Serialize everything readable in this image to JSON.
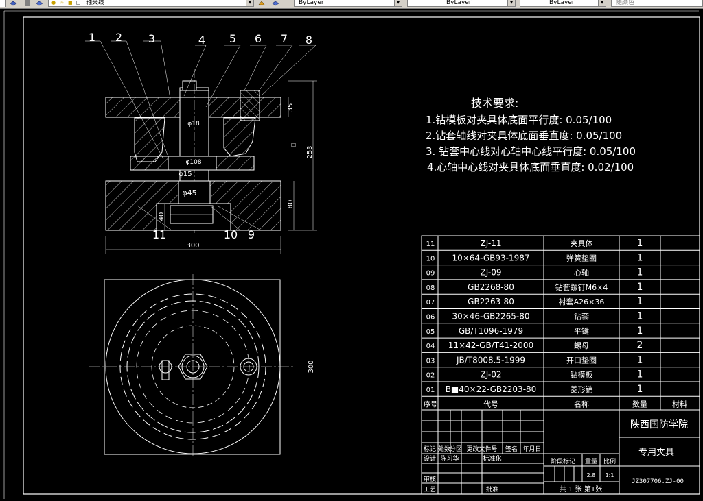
{
  "toolbar": {
    "layer_name": "轴夹线",
    "color_value": "ByLayer",
    "linetype_value": "ByLayer",
    "lineweight_value": "ByLayer",
    "plotstyle_value": "随颜色"
  },
  "drawing": {
    "balloons": [
      "1",
      "2",
      "3",
      "4",
      "5",
      "6",
      "7",
      "8",
      "9",
      "10",
      "11"
    ],
    "dims": {
      "width_front": "300",
      "height_total": "253",
      "top_plate": "35",
      "base_height": "80",
      "pocket_depth": "40",
      "side_plan": "300",
      "dia_108": "φ108",
      "dia_15": "φ15",
      "dia_45": "φ45",
      "dia_18": "φ18"
    },
    "tech_title": "技术要求:",
    "tech_items": [
      "1.钻模板对夹具体底面平行度: 0.05/100",
      "2.钻套轴线对夹具体底面垂直度: 0.05/100",
      "3.  钻套中心线对心轴中心线平行度: 0.05/100",
      "4.心轴中心线对夹具体底面垂直度: 0.02/100"
    ]
  },
  "bom": {
    "rows": [
      {
        "no": "11",
        "code": "ZJ-11",
        "name": "夹具体",
        "qty": "1"
      },
      {
        "no": "10",
        "code": "10×64-GB93-1987",
        "name": "弹簧垫圈",
        "qty": "1"
      },
      {
        "no": "09",
        "code": "ZJ-09",
        "name": "心轴",
        "qty": "1"
      },
      {
        "no": "08",
        "code": "GB2268-80",
        "name": "钻套螺钉M6×4",
        "qty": "1"
      },
      {
        "no": "07",
        "code": "GB2263-80",
        "name": "衬套A26×36",
        "qty": "1"
      },
      {
        "no": "06",
        "code": "30×46-GB2265-80",
        "name": "钻套",
        "qty": "1"
      },
      {
        "no": "05",
        "code": "GB/T1096-1979",
        "name": "平键",
        "qty": "1"
      },
      {
        "no": "04",
        "code": "11×42-GB/T41-2000",
        "name": "螺母",
        "qty": "2"
      },
      {
        "no": "03",
        "code": "JB/T8008.5-1999",
        "name": "开口垫圈",
        "qty": "1"
      },
      {
        "no": "02",
        "code": "ZJ-02",
        "name": "钻模板",
        "qty": "1"
      },
      {
        "no": "01",
        "code": "B■40×22-GB2203-80",
        "name": "菱形销",
        "qty": "1"
      }
    ],
    "header": {
      "no": "序号",
      "code": "代号",
      "name": "名称",
      "qty": "数量",
      "material": "材料"
    }
  },
  "title_block": {
    "school": "陕西国防学院",
    "drawing_name": "专用夹具",
    "drawing_no": "JZ307706.ZJ-00",
    "labels": {
      "mark": "标记",
      "count": "处数",
      "zone": "分区",
      "change_doc": "更改文件号",
      "sign": "签名",
      "date": "年月日",
      "design": "设计",
      "sign2": "陈习华",
      "standard": "标准化",
      "stage": "阶段标记",
      "weight": "重量",
      "scale": "比例",
      "review": "审核",
      "process": "工艺",
      "approve": "批准"
    },
    "weight_value": "2.8",
    "scale_value": "1:1",
    "sheets": "共 1 张 第1张"
  }
}
